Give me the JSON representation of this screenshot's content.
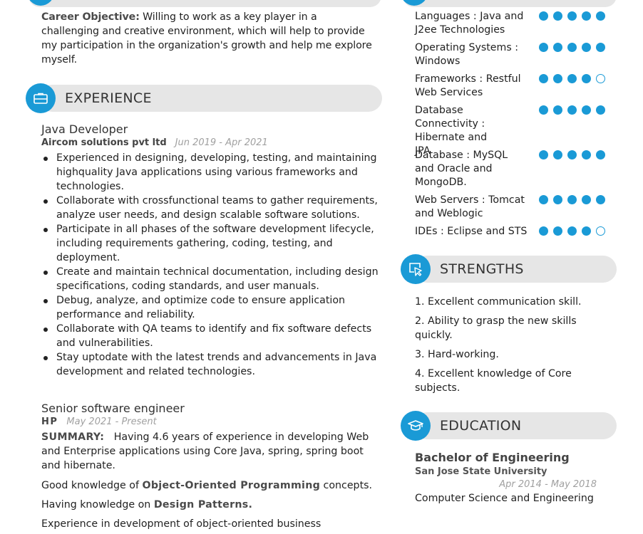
{
  "objective": {
    "label": "Career Objective:",
    "text": " Willing to work as a key player in a challenging and creative environment, which will help to provide my participation in the organization's growth and help me explore myself."
  },
  "experience": {
    "heading": "EXPERIENCE",
    "icon": "briefcase-icon",
    "jobs": [
      {
        "title": "Java Developer",
        "company": "Aircom solutions pvt ltd",
        "dates": "Jun 2019 - Apr 2021",
        "bullets": [
          "Experienced in designing, developing, testing, and maintaining highquality Java applications using various frameworks and technologies.",
          "Collaborate with crossfunctional teams to gather requirements, analyze user needs, and design scalable software solutions.",
          "Participate in all phases of the software development lifecycle, including requirements gathering, coding, testing, and deployment.",
          "Create and maintain technical documentation, including design specifications, coding standards, and user manuals.",
          "Debug, analyze, and optimize code to ensure application performance and reliability.",
          "Collaborate with QA teams to identify and fix software defects and vulnerabilities.",
          "Stay uptodate with the latest trends and advancements in Java development and related technologies."
        ]
      },
      {
        "title": "Senior software engineer",
        "company": "HP",
        "dates": "May 2021 - Present",
        "summary_label": "SUMMARY:",
        "summary_text": "Having 4.6 years of experience in developing Web and Enterprise applications using Core Java, spring, spring boot and hibernate.",
        "p1_pre": "Good knowledge of ",
        "p1_bold": "Object-Oriented Programming",
        "p1_post": " concepts.",
        "p2_pre": "Having knowledge on ",
        "p2_bold": "Design Patterns.",
        "p3": "Experience in development of object-oriented business"
      }
    ]
  },
  "skills": [
    {
      "name": "Languages : Java and J2ee Technologies",
      "rating": 5,
      "max": 5
    },
    {
      "name": "Operating Systems : Windows",
      "rating": 5,
      "max": 5
    },
    {
      "name": "Frameworks : Restful Web Services",
      "rating": 4,
      "max": 5
    },
    {
      "name": "Database Connectivity : Hibernate and JPA",
      "rating": 5,
      "max": 5
    },
    {
      "name": "Database : MySQL and Oracle and MongoDB.",
      "rating": 5,
      "max": 5
    },
    {
      "name": "Web Servers : Tomcat and Weblogic",
      "rating": 5,
      "max": 5
    },
    {
      "name": "IDEs : Eclipse and STS",
      "rating": 4,
      "max": 5
    }
  ],
  "strengths": {
    "heading": "STRENGTHS",
    "icon": "cursor-click-icon",
    "items": [
      "1. Excellent communication skill.",
      "2. Ability to grasp the new skills quickly.",
      "3. Hard-working.",
      "4. Excellent knowledge of Core subjects."
    ]
  },
  "education": {
    "heading": "EDUCATION",
    "icon": "graduation-cap-icon",
    "degree": "Bachelor of Engineering",
    "school": "San Jose State University",
    "dates": "Apr 2014 - May 2018",
    "field": "Computer Science and Engineering"
  },
  "colors": {
    "accent": "#1a9ad6",
    "header_bar": "#e6e6e6",
    "muted_date": "#a0a0a0"
  }
}
